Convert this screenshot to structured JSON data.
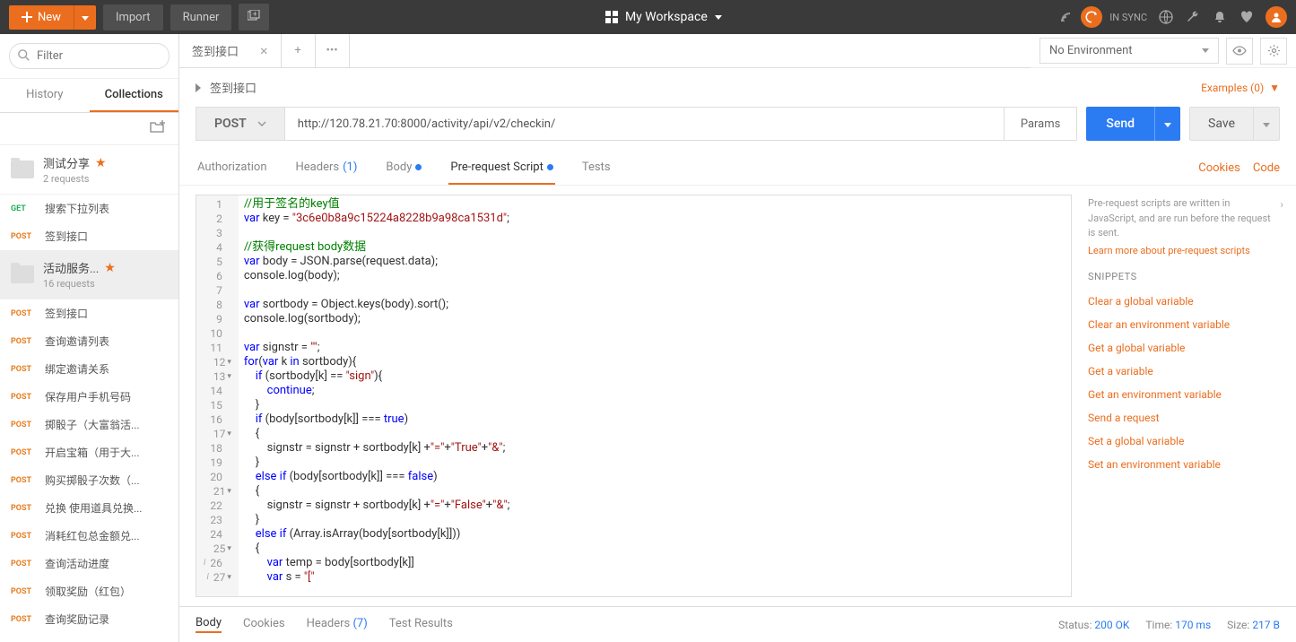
{
  "topbar": {
    "new": "New",
    "import": "Import",
    "runner": "Runner",
    "workspace": "My Workspace",
    "sync": "IN SYNC"
  },
  "sidebar": {
    "filter_placeholder": "Filter",
    "tabs": {
      "history": "History",
      "collections": "Collections"
    },
    "collections": [
      {
        "name": "测试分享",
        "sub": "2 requests",
        "star": true
      },
      {
        "name": "活动服务...",
        "sub": "16 requests",
        "star": true
      }
    ],
    "requests": [
      {
        "method": "GET",
        "name": "搜索下拉列表"
      },
      {
        "method": "POST",
        "name": "签到接口"
      },
      {
        "method": "POST",
        "name": "签到接口"
      },
      {
        "method": "POST",
        "name": "查询邀请列表"
      },
      {
        "method": "POST",
        "name": "绑定邀请关系"
      },
      {
        "method": "POST",
        "name": "保存用户手机号码"
      },
      {
        "method": "POST",
        "name": "掷骰子（大富翁活..."
      },
      {
        "method": "POST",
        "name": "开启宝箱（用于大..."
      },
      {
        "method": "POST",
        "name": "购买掷骰子次数（..."
      },
      {
        "method": "POST",
        "name": "兑换 使用道具兑换..."
      },
      {
        "method": "POST",
        "name": "消耗红包总金额兑..."
      },
      {
        "method": "POST",
        "name": "查询活动进度"
      },
      {
        "method": "POST",
        "name": "领取奖励（红包）"
      },
      {
        "method": "POST",
        "name": "查询奖励记录"
      }
    ]
  },
  "env": {
    "selected": "No Environment"
  },
  "tab": {
    "name": "签到接口"
  },
  "breadcrumb": {
    "name": "签到接口",
    "examples": "Examples (0)"
  },
  "request": {
    "method": "POST",
    "url": "http://120.78.21.70:8000/activity/api/v2/checkin/",
    "params": "Params",
    "send": "Send",
    "save": "Save"
  },
  "reqtabs": {
    "auth": "Authorization",
    "headers": "Headers",
    "headers_count": "(1)",
    "body": "Body",
    "prerequest": "Pre-request Script",
    "tests": "Tests",
    "cookies": "Cookies",
    "code": "Code"
  },
  "code_lines": [
    {
      "n": 1,
      "html": "<span class='c-com'>//用于签名的key值</span>"
    },
    {
      "n": 2,
      "html": "<span class='c-kw'>var</span> key = <span class='c-str'>\"3c6e0b8a9c15224a8228b9a98ca1531d\"</span>;"
    },
    {
      "n": 3,
      "html": ""
    },
    {
      "n": 4,
      "html": "<span class='c-com'>//获得request body数据</span>"
    },
    {
      "n": 5,
      "html": "<span class='c-kw'>var</span> body = JSON.parse(request.data);"
    },
    {
      "n": 6,
      "html": "console.log(body);"
    },
    {
      "n": 7,
      "html": ""
    },
    {
      "n": 8,
      "html": "<span class='c-kw'>var</span> sortbody = Object.keys(body).sort();"
    },
    {
      "n": 9,
      "html": "console.log(sortbody);"
    },
    {
      "n": 10,
      "html": ""
    },
    {
      "n": 11,
      "html": "<span class='c-kw'>var</span> signstr = <span class='c-str'>\"\"</span>;"
    },
    {
      "n": 12,
      "fold": true,
      "html": "<span class='c-kw'>for</span>(<span class='c-kw'>var</span> k <span class='c-kw'>in</span> sortbody){"
    },
    {
      "n": 13,
      "fold": true,
      "html": "    <span class='c-kw'>if</span> (sortbody[k] == <span class='c-str'>\"sign\"</span>){"
    },
    {
      "n": 14,
      "html": "        <span class='c-kw'>continue</span>;"
    },
    {
      "n": 15,
      "html": "    }"
    },
    {
      "n": 16,
      "html": "    <span class='c-kw'>if</span> (body[sortbody[k]] === <span class='c-kw'>true</span>)"
    },
    {
      "n": 17,
      "fold": true,
      "html": "    {"
    },
    {
      "n": 18,
      "html": "        signstr = signstr + sortbody[k] +<span class='c-str'>\"=\"</span>+<span class='c-str'>\"True\"</span>+<span class='c-str'>\"&\"</span>;"
    },
    {
      "n": 19,
      "html": "    }"
    },
    {
      "n": 20,
      "html": "    <span class='c-kw'>else</span> <span class='c-kw'>if</span> (body[sortbody[k]] === <span class='c-kw'>false</span>)"
    },
    {
      "n": 21,
      "fold": true,
      "html": "    {"
    },
    {
      "n": 22,
      "html": "        signstr = signstr + sortbody[k] +<span class='c-str'>\"=\"</span>+<span class='c-str'>\"False\"</span>+<span class='c-str'>\"&\"</span>;"
    },
    {
      "n": 23,
      "html": "    }"
    },
    {
      "n": 24,
      "html": "    <span class='c-kw'>else</span> <span class='c-kw'>if</span> (Array.isArray(body[sortbody[k]]))"
    },
    {
      "n": 25,
      "fold": true,
      "html": "    {"
    },
    {
      "n": 26,
      "info": true,
      "html": "        <span class='c-kw'>var</span> temp = body[sortbody[k]]"
    },
    {
      "n": 27,
      "info": true,
      "fold": true,
      "html": "        <span class='c-kw'>var</span> s = <span class='c-str'>\"[\"</span>"
    }
  ],
  "snippets": {
    "hint": "Pre-request scripts are written in JavaScript, and are run before the request is sent.",
    "learn": "Learn more about pre-request scripts",
    "title": "SNIPPETS",
    "items": [
      "Clear a global variable",
      "Clear an environment variable",
      "Get a global variable",
      "Get a variable",
      "Get an environment variable",
      "Send a request",
      "Set a global variable",
      "Set an environment variable"
    ]
  },
  "response": {
    "tabs": {
      "body": "Body",
      "cookies": "Cookies",
      "headers": "Headers",
      "headers_count": "(7)",
      "tests": "Test Results"
    },
    "status_label": "Status:",
    "status": "200 OK",
    "time_label": "Time:",
    "time": "170 ms",
    "size_label": "Size:",
    "size": "217 B"
  }
}
